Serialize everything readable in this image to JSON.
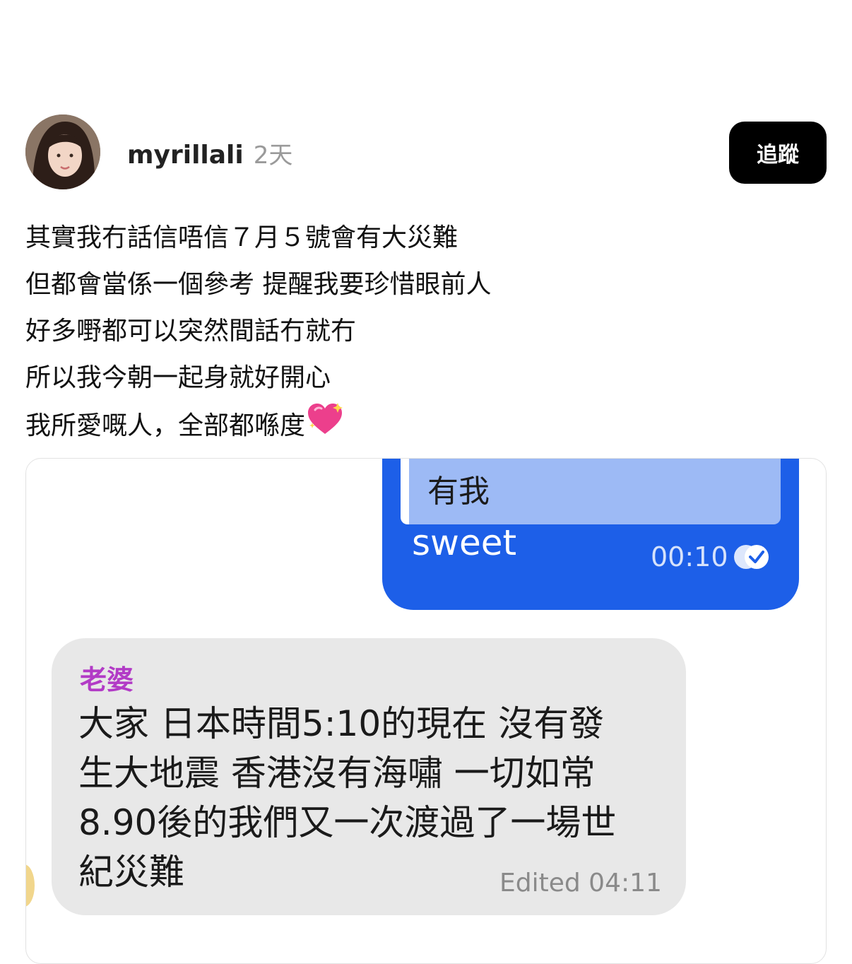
{
  "post": {
    "username": "myrillali",
    "time_ago": "2天",
    "follow_label": "追蹤",
    "caption_lines": [
      "其實我冇話信唔信７月５號會有大災難",
      "但都會當係一個參考 提醒我要珍惜眼前人",
      "好多嘢都可以突然間話冇就冇",
      "所以我今朝一起身就好開心",
      "我所愛嘅人，全部都喺度"
    ],
    "caption_emoji": "sparkling-heart-icon"
  },
  "chat": {
    "outgoing": {
      "quoted_text": "有我",
      "text": "sweet",
      "time": "00:10",
      "status_icon": "read-double-check-icon"
    },
    "incoming": {
      "sender": "老婆",
      "lines": [
        "大家 日本時間5:10的現在 沒有發",
        "生大地震 香港沒有海嘯 一切如常",
        "8.90後的我們又一次渡過了一場世",
        "紀災難"
      ],
      "edited_label": "Edited 04:11"
    },
    "colors": {
      "outgoing_bubble": "#1d5fe8",
      "quote_box": "#9dbaf5",
      "incoming_bubble": "#e8e8e8",
      "sender_name": "#b23bc6"
    }
  }
}
